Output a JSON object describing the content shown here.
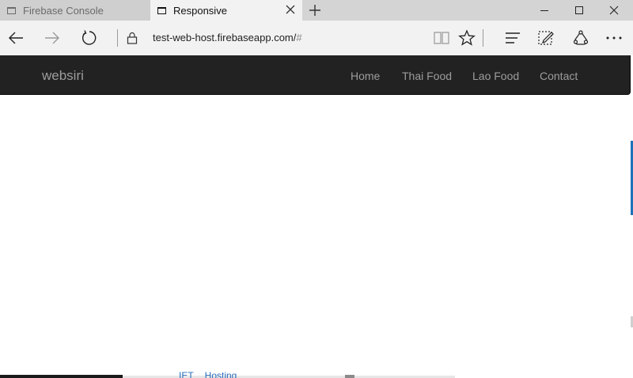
{
  "tabs": [
    {
      "title": "Firebase Console",
      "active": false
    },
    {
      "title": "Responsive",
      "active": true
    }
  ],
  "addressbar": {
    "url_main": "test-web-host.firebaseapp.com/",
    "url_fragment": "#"
  },
  "site": {
    "brand": "websiri",
    "nav": [
      "Home",
      "Thai Food",
      "Lao Food",
      "Contact"
    ]
  },
  "partial_text": {
    "left": "IET",
    "right": "Hosting"
  },
  "colors": {
    "navbar_bg": "#222222",
    "nav_text": "#9d9d9d",
    "accent": "#1e73b8"
  }
}
